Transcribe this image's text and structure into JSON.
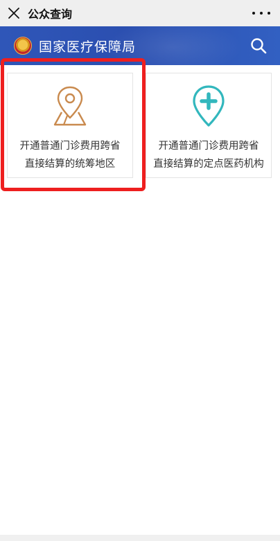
{
  "topbar": {
    "title": "公众查询",
    "close_icon": "close-icon",
    "more_icon": "more-dots-icon"
  },
  "banner": {
    "title": "国家医疗保障局",
    "emblem": "national-emblem-icon",
    "search_icon": "search-icon",
    "color": "#2f56b8"
  },
  "cards": [
    {
      "icon": "map-pin-icon",
      "icon_color": "#c98a4e",
      "line1": "开通普通门诊费用跨省",
      "line2": "直接结算的统筹地区"
    },
    {
      "icon": "location-plus-icon",
      "icon_color": "#32b7bd",
      "line1": "开通普通门诊费用跨省",
      "line2": "直接结算的定点医药机构"
    }
  ],
  "highlight_color": "#ee1f1f"
}
